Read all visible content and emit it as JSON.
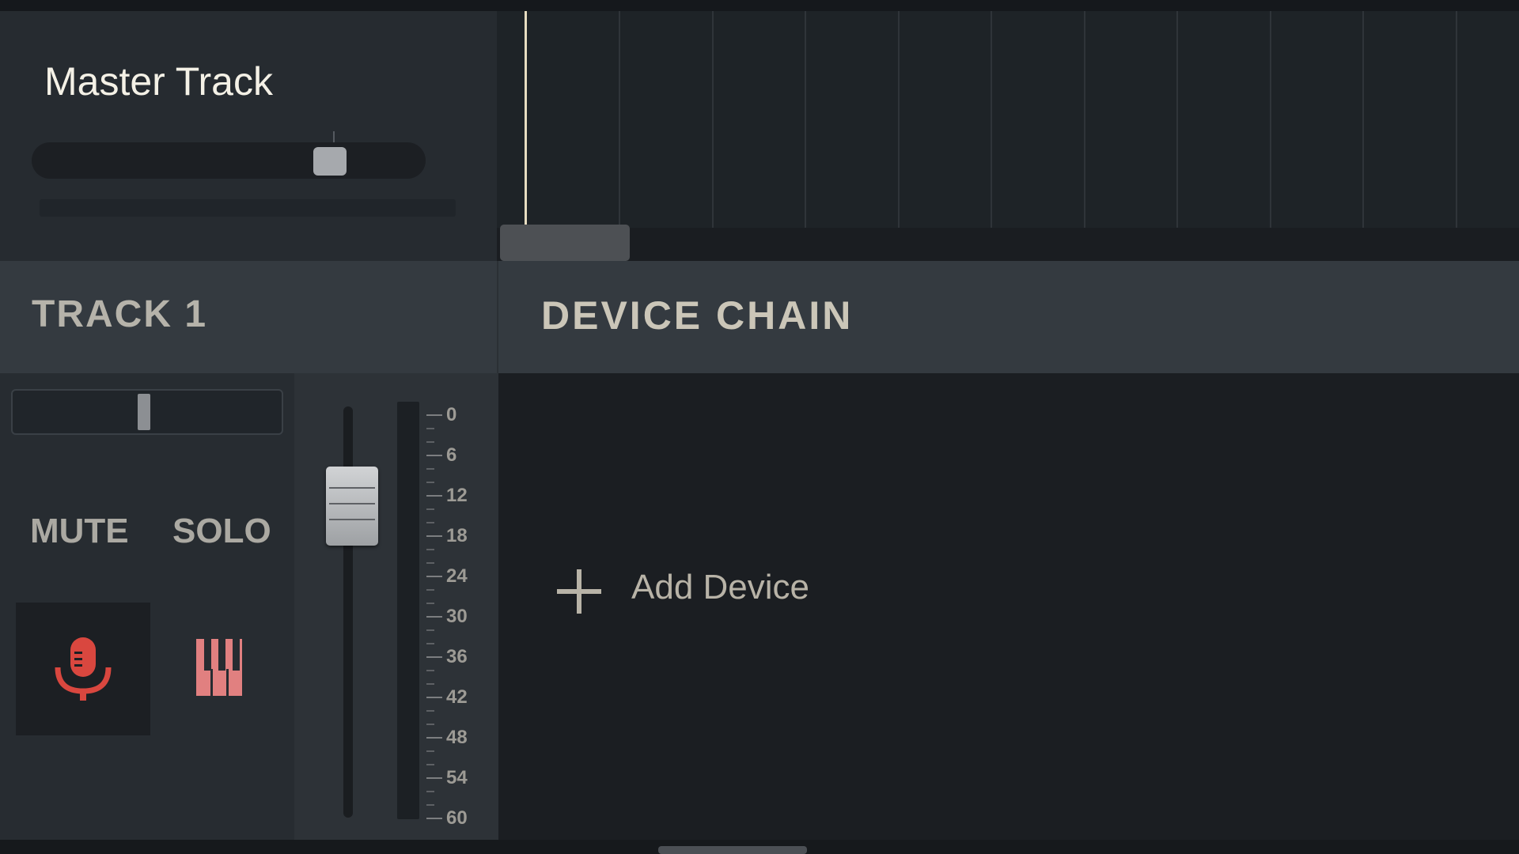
{
  "master": {
    "title": "Master Track",
    "volume_fraction": 0.78
  },
  "track": {
    "name": "TRACK 1",
    "pan_fraction": 0.48,
    "mute_label": "MUTE",
    "solo_label": "SOLO",
    "record_icon": "microphone-icon",
    "instrument_icon": "piano-keys-icon",
    "meter_scale": [
      "0",
      "6",
      "12",
      "18",
      "24",
      "30",
      "36",
      "42",
      "48",
      "54",
      "60"
    ]
  },
  "device_chain": {
    "title": "DEVICE CHAIN",
    "add_label": "Add Device"
  },
  "colors": {
    "record_accent": "#d9473f",
    "instrument_accent": "#e18080",
    "playhead": "#e7ddc1"
  }
}
